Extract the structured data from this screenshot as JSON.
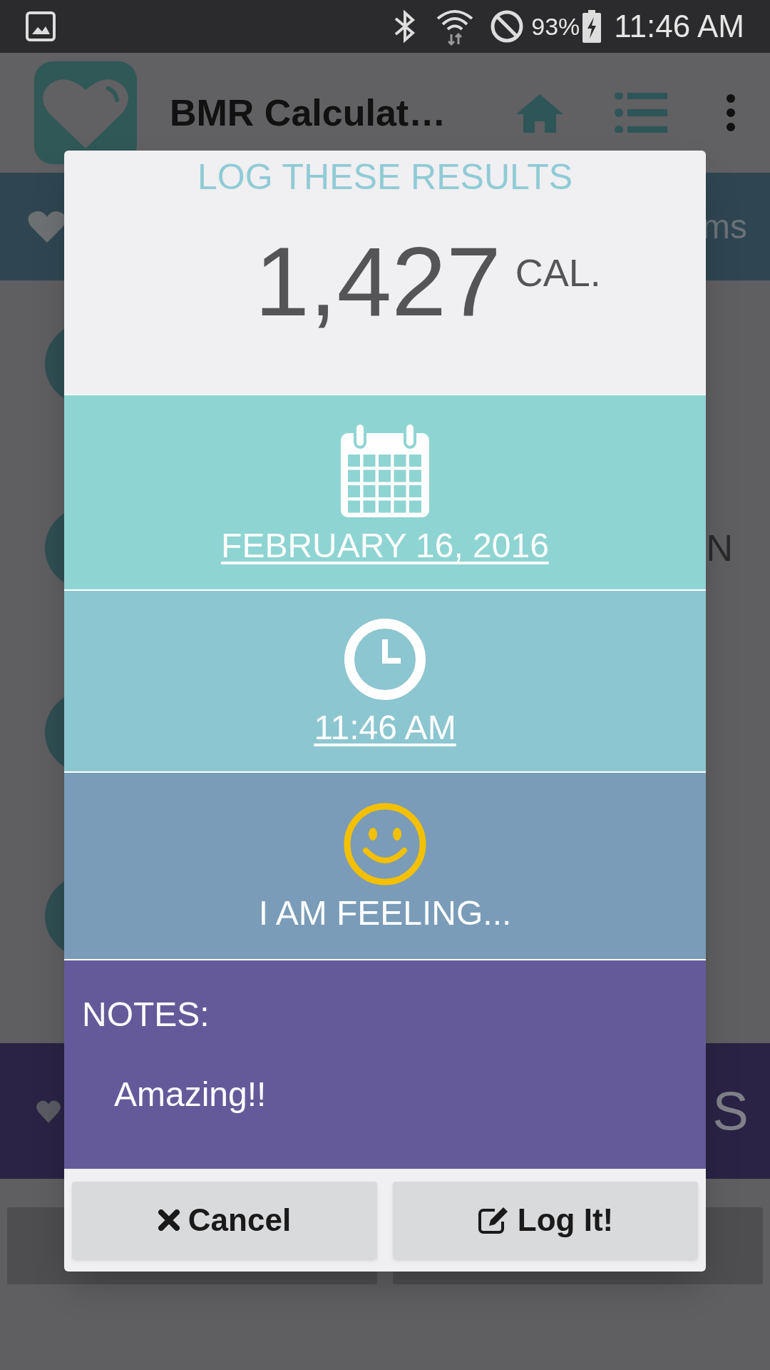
{
  "status_bar": {
    "battery": "93%",
    "time": "11:46 AM"
  },
  "app_bar": {
    "title": "BMR Calculat…"
  },
  "background": {
    "tab_text": "ms",
    "row_text": "N",
    "banner_text": "S"
  },
  "dialog": {
    "title": "LOG THESE RESULTS",
    "calories": "1,427",
    "unit": "CAL.",
    "sections": [
      {
        "kind": "date",
        "label": "FEBRUARY 16, 2016"
      },
      {
        "kind": "time",
        "label": "11:46 AM"
      },
      {
        "kind": "mood",
        "label": "I AM FEELING..."
      }
    ],
    "notes_label": "NOTES:",
    "notes": "Amazing!!",
    "buttons": [
      {
        "kind": "cancel",
        "label": "Cancel"
      },
      {
        "kind": "log",
        "label": "Log It!"
      }
    ]
  }
}
